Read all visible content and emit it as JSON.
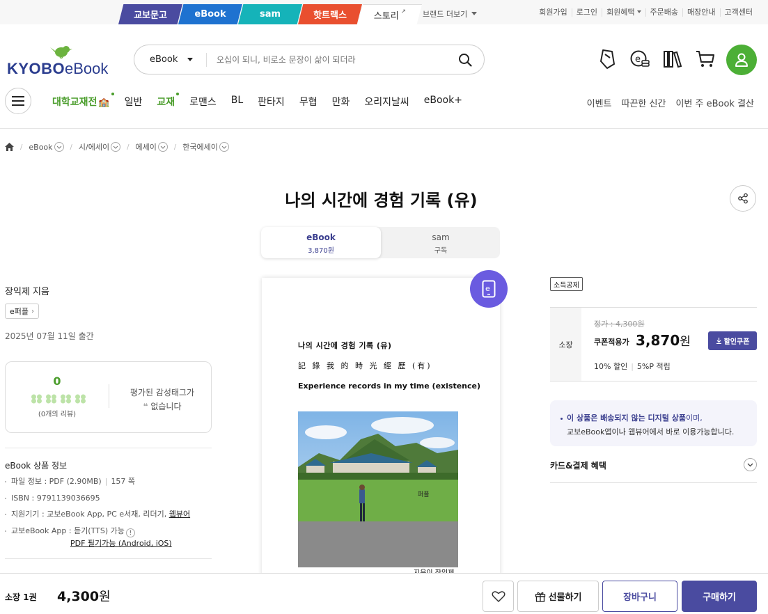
{
  "brand_tabs": [
    "교보문고",
    "eBook",
    "sam",
    "핫트랙스",
    "스토리"
  ],
  "brand_more": "브랜드 더보기",
  "util_links": [
    "회원가입",
    "로그인",
    "회원혜택",
    "주문배송",
    "매장안내",
    "고객센터"
  ],
  "logo": {
    "kyobo": "KYOBO",
    "ebook": "eBook"
  },
  "search": {
    "category": "eBook",
    "placeholder": "오십이 되니, 비로소 문장이 삶이 되더라"
  },
  "header_icons": [
    "bookmark-icon",
    "ecash-icon",
    "library-icon",
    "cart-icon",
    "profile-icon"
  ],
  "nav": {
    "items": [
      "대학교재전",
      "일반",
      "교재",
      "로맨스",
      "BL",
      "판타지",
      "무협",
      "만화",
      "오리지날씨",
      "eBook+"
    ],
    "right": [
      "이벤트",
      "따끈한 신간",
      "이번 주 eBook 결산"
    ]
  },
  "breadcrumb": [
    "eBook",
    "시/에세이",
    "에세이",
    "한국에세이"
  ],
  "title": "나의 시간에 경험 기록 (유)",
  "format_tabs": [
    {
      "label": "eBook",
      "sub": "3,870원"
    },
    {
      "label": "sam",
      "sub": "구독"
    }
  ],
  "author": "장익제 지음",
  "publisher": "e퍼플",
  "pub_date": "2025년 07월 11일 출간",
  "review": {
    "score": "0",
    "count": "(0개의 리뷰)",
    "tags_line1": "평가된 감성태그가",
    "tags_line2": "없습니다"
  },
  "ebook_info": {
    "title": "eBook 상품 정보",
    "file": "파일 정보 : PDF (2.90MB)",
    "pages": "157 쪽",
    "isbn": "ISBN : 9791139036695",
    "devices_prefix": "지원기기 : 교보eBook App, PC e서재, 리더기, ",
    "devices_link": "웹뷰어",
    "app": "교보eBook App : 듣기(TTS) 가능",
    "tts_icon": "!",
    "pdf_note": "PDF 필기가능 (Android, iOS)"
  },
  "cover": {
    "line1": "나의 시간에 경험 기록 (유)",
    "line2": "記 錄 我 的 時 光 經 歷 (有)",
    "line3": "Experience records in my time (existence)",
    "author": "지은이 장익제"
  },
  "price": {
    "tax_badge": "소득공제",
    "label": "소장",
    "original": "정가 : 4,300원",
    "coupon_label": "쿠폰적용가",
    "coupon_price": "3,870",
    "won": "원",
    "coupon_button": "할인쿠폰",
    "discount": "10% 할인",
    "points": "5%P 적립"
  },
  "notice": {
    "bold": "이 상품은 배송되지 않는 디지털 상품",
    "rest1": "이며,",
    "line2": "교보eBook앱이나 웹뷰어에서 바로 이용가능합니다."
  },
  "benefits": "카드&결제 혜택",
  "bottom": {
    "own": "소장 1권",
    "total": "4,300",
    "won": "원",
    "gift": "선물하기",
    "cart": "장바구니",
    "buy": "구매하기"
  },
  "colors": {
    "primary": "#4a4ba0",
    "green": "#4caf36",
    "ebadge": "#6a5be0"
  }
}
